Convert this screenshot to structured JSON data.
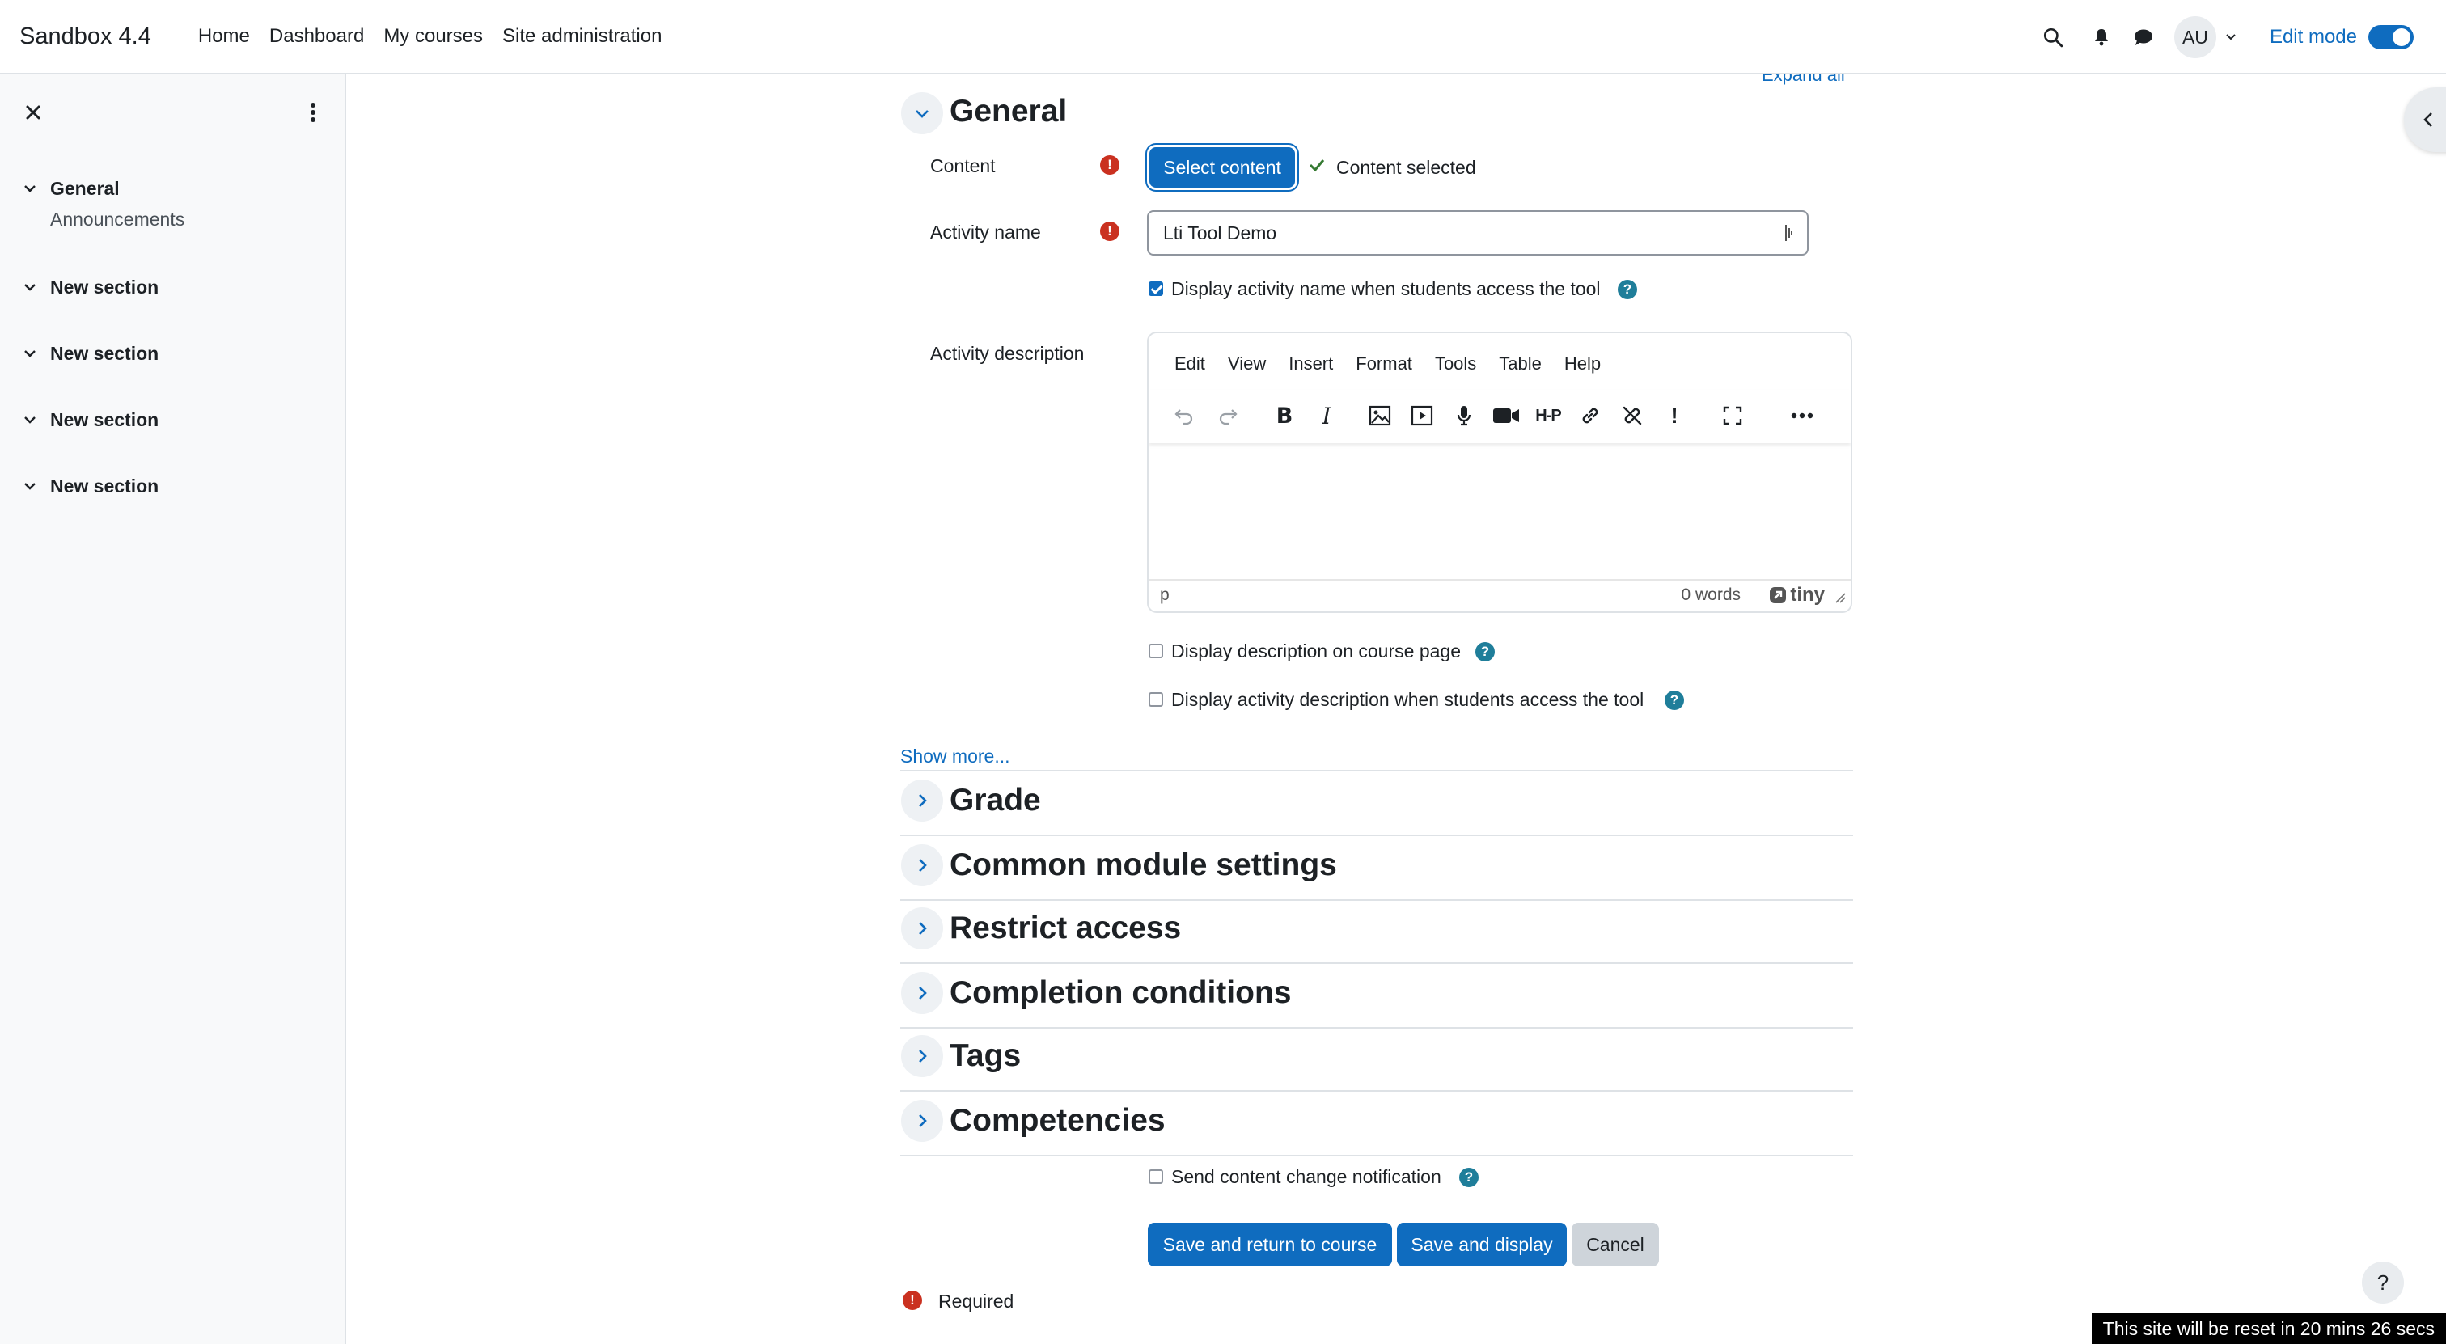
{
  "navbar": {
    "brand": "Sandbox 4.4",
    "links": [
      "Home",
      "Dashboard",
      "My courses",
      "Site administration"
    ],
    "avatar_initials": "AU",
    "edit_mode_label": "Edit mode",
    "edit_mode_on": true
  },
  "course_index": {
    "sections": [
      {
        "title": "General",
        "items": [
          "Announcements"
        ]
      },
      {
        "title": "New section",
        "items": []
      },
      {
        "title": "New section",
        "items": []
      },
      {
        "title": "New section",
        "items": []
      },
      {
        "title": "New section",
        "items": []
      }
    ]
  },
  "form": {
    "expand_all": "Expand all",
    "general_title": "General",
    "content_label": "Content",
    "select_content_button": "Select content",
    "content_selected": "Content selected",
    "activity_name_label": "Activity name",
    "activity_name_value": "Lti Tool Demo",
    "display_name_checkbox": "Display activity name when students access the tool",
    "display_name_checked": true,
    "activity_description_label": "Activity description",
    "editor": {
      "menus": [
        "Edit",
        "View",
        "Insert",
        "Format",
        "Tools",
        "Table",
        "Help"
      ],
      "path": "p",
      "word_count": "0 words",
      "brand": "tiny"
    },
    "display_desc_course_page": "Display description on course page",
    "display_desc_course_page_checked": false,
    "display_desc_tool": "Display activity description when students access the tool",
    "display_desc_tool_checked": false,
    "show_more": "Show more...",
    "collapsed_sections": [
      "Grade",
      "Common module settings",
      "Restrict access",
      "Completion conditions",
      "Tags",
      "Competencies"
    ],
    "send_notification": "Send content change notification",
    "send_notification_checked": false,
    "buttons": {
      "save_return": "Save and return to course",
      "save_display": "Save and display",
      "cancel": "Cancel"
    },
    "required_label": "Required"
  },
  "reset_notice": "This site will be reset in 20 mins 26 secs",
  "help_button": "?",
  "colors": {
    "primary": "#0f6cbf",
    "required": "#ca3120",
    "help": "#1f7e9a",
    "success": "#357a32"
  }
}
